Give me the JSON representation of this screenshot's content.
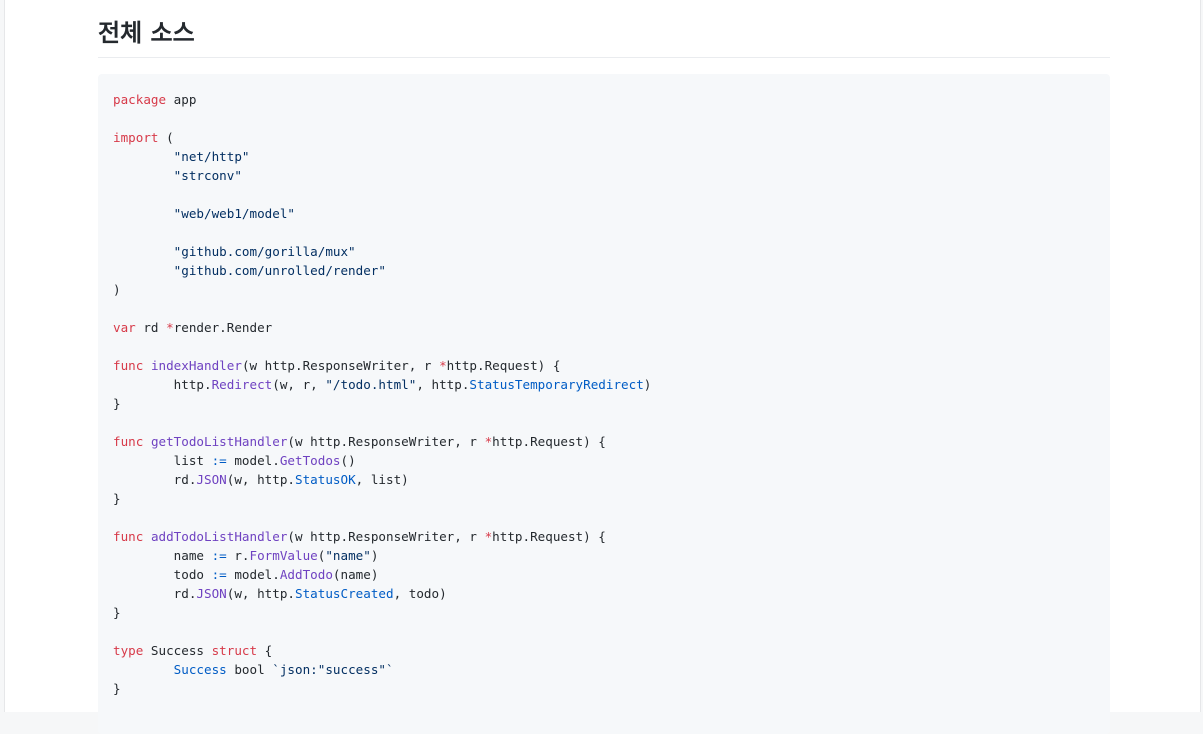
{
  "heading": "전체 소스",
  "code": {
    "language": "go",
    "colors": {
      "keyword": "#d73a49",
      "function": "#6f42c1",
      "constant": "#005cc5",
      "string": "#032f62",
      "text": "#24292e",
      "background": "#f6f8fa"
    },
    "lines": [
      [
        [
          "k",
          "package"
        ],
        [
          "t",
          " app"
        ]
      ],
      [],
      [
        [
          "k",
          "import"
        ],
        [
          "t",
          " ("
        ]
      ],
      [
        [
          "t",
          "        "
        ],
        [
          "s",
          "\"net/http\""
        ]
      ],
      [
        [
          "t",
          "        "
        ],
        [
          "s",
          "\"strconv\""
        ]
      ],
      [],
      [
        [
          "t",
          "        "
        ],
        [
          "s",
          "\"web/web1/model\""
        ]
      ],
      [],
      [
        [
          "t",
          "        "
        ],
        [
          "s",
          "\"github.com/gorilla/mux\""
        ]
      ],
      [
        [
          "t",
          "        "
        ],
        [
          "s",
          "\"github.com/unrolled/render\""
        ]
      ],
      [
        [
          "t",
          ")"
        ]
      ],
      [],
      [
        [
          "k",
          "var"
        ],
        [
          "t",
          " rd "
        ],
        [
          "k",
          "*"
        ],
        [
          "t",
          "render.Render"
        ]
      ],
      [],
      [
        [
          "k",
          "func"
        ],
        [
          "t",
          " "
        ],
        [
          "f",
          "indexHandler"
        ],
        [
          "t",
          "(w http.ResponseWriter, r "
        ],
        [
          "k",
          "*"
        ],
        [
          "t",
          "http.Request) {"
        ]
      ],
      [
        [
          "t",
          "        http."
        ],
        [
          "f",
          "Redirect"
        ],
        [
          "t",
          "(w, r, "
        ],
        [
          "s",
          "\"/todo.html\""
        ],
        [
          "t",
          ", http."
        ],
        [
          "c",
          "StatusTemporaryRedirect"
        ],
        [
          "t",
          ")"
        ]
      ],
      [
        [
          "t",
          "}"
        ]
      ],
      [],
      [
        [
          "k",
          "func"
        ],
        [
          "t",
          " "
        ],
        [
          "f",
          "getTodoListHandler"
        ],
        [
          "t",
          "(w http.ResponseWriter, r "
        ],
        [
          "k",
          "*"
        ],
        [
          "t",
          "http.Request) {"
        ]
      ],
      [
        [
          "t",
          "        list "
        ],
        [
          "c",
          ":="
        ],
        [
          "t",
          " model."
        ],
        [
          "f",
          "GetTodos"
        ],
        [
          "t",
          "()"
        ]
      ],
      [
        [
          "t",
          "        rd."
        ],
        [
          "f",
          "JSON"
        ],
        [
          "t",
          "(w, http."
        ],
        [
          "c",
          "StatusOK"
        ],
        [
          "t",
          ", list)"
        ]
      ],
      [
        [
          "t",
          "}"
        ]
      ],
      [],
      [
        [
          "k",
          "func"
        ],
        [
          "t",
          " "
        ],
        [
          "f",
          "addTodoListHandler"
        ],
        [
          "t",
          "(w http.ResponseWriter, r "
        ],
        [
          "k",
          "*"
        ],
        [
          "t",
          "http.Request) {"
        ]
      ],
      [
        [
          "t",
          "        name "
        ],
        [
          "c",
          ":="
        ],
        [
          "t",
          " r."
        ],
        [
          "f",
          "FormValue"
        ],
        [
          "t",
          "("
        ],
        [
          "s",
          "\"name\""
        ],
        [
          "t",
          ")"
        ]
      ],
      [
        [
          "t",
          "        todo "
        ],
        [
          "c",
          ":="
        ],
        [
          "t",
          " model."
        ],
        [
          "f",
          "AddTodo"
        ],
        [
          "t",
          "(name)"
        ]
      ],
      [
        [
          "t",
          "        rd."
        ],
        [
          "f",
          "JSON"
        ],
        [
          "t",
          "(w, http."
        ],
        [
          "c",
          "StatusCreated"
        ],
        [
          "t",
          ", todo)"
        ]
      ],
      [
        [
          "t",
          "}"
        ]
      ],
      [],
      [
        [
          "k",
          "type"
        ],
        [
          "t",
          " Success "
        ],
        [
          "k",
          "struct"
        ],
        [
          "t",
          " {"
        ]
      ],
      [
        [
          "t",
          "        "
        ],
        [
          "c",
          "Success"
        ],
        [
          "t",
          " bool "
        ],
        [
          "s",
          "`json:\"success\"`"
        ]
      ],
      [
        [
          "t",
          "}"
        ]
      ]
    ]
  }
}
